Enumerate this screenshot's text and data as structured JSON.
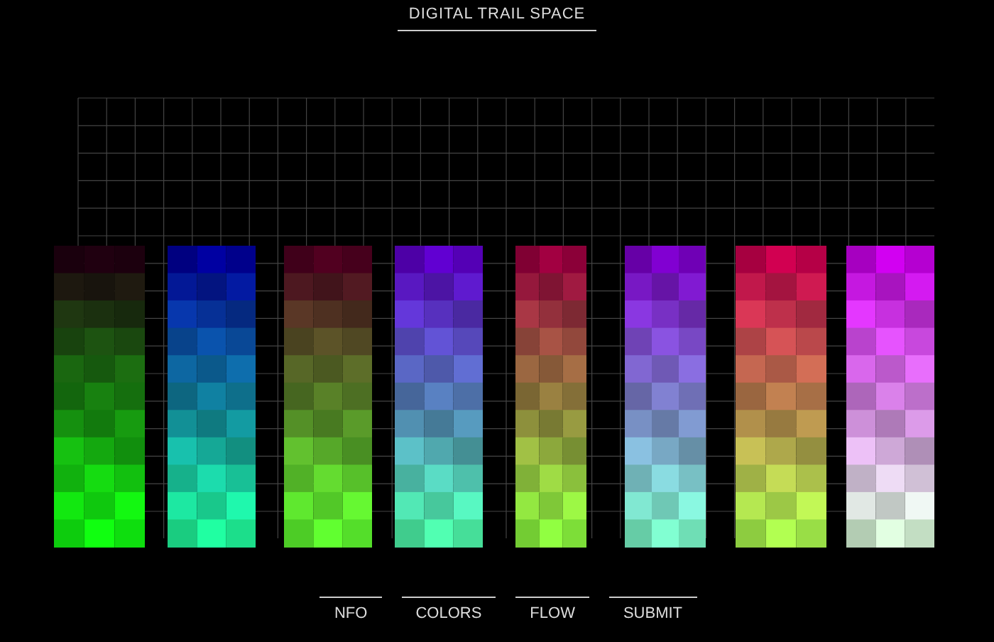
{
  "title": "DIGITAL TRAIL SPACE",
  "nav": [
    {
      "label": "NFO"
    },
    {
      "label": "COLORS"
    },
    {
      "label": "FLOW"
    },
    {
      "label": "SUBMIT"
    }
  ]
}
